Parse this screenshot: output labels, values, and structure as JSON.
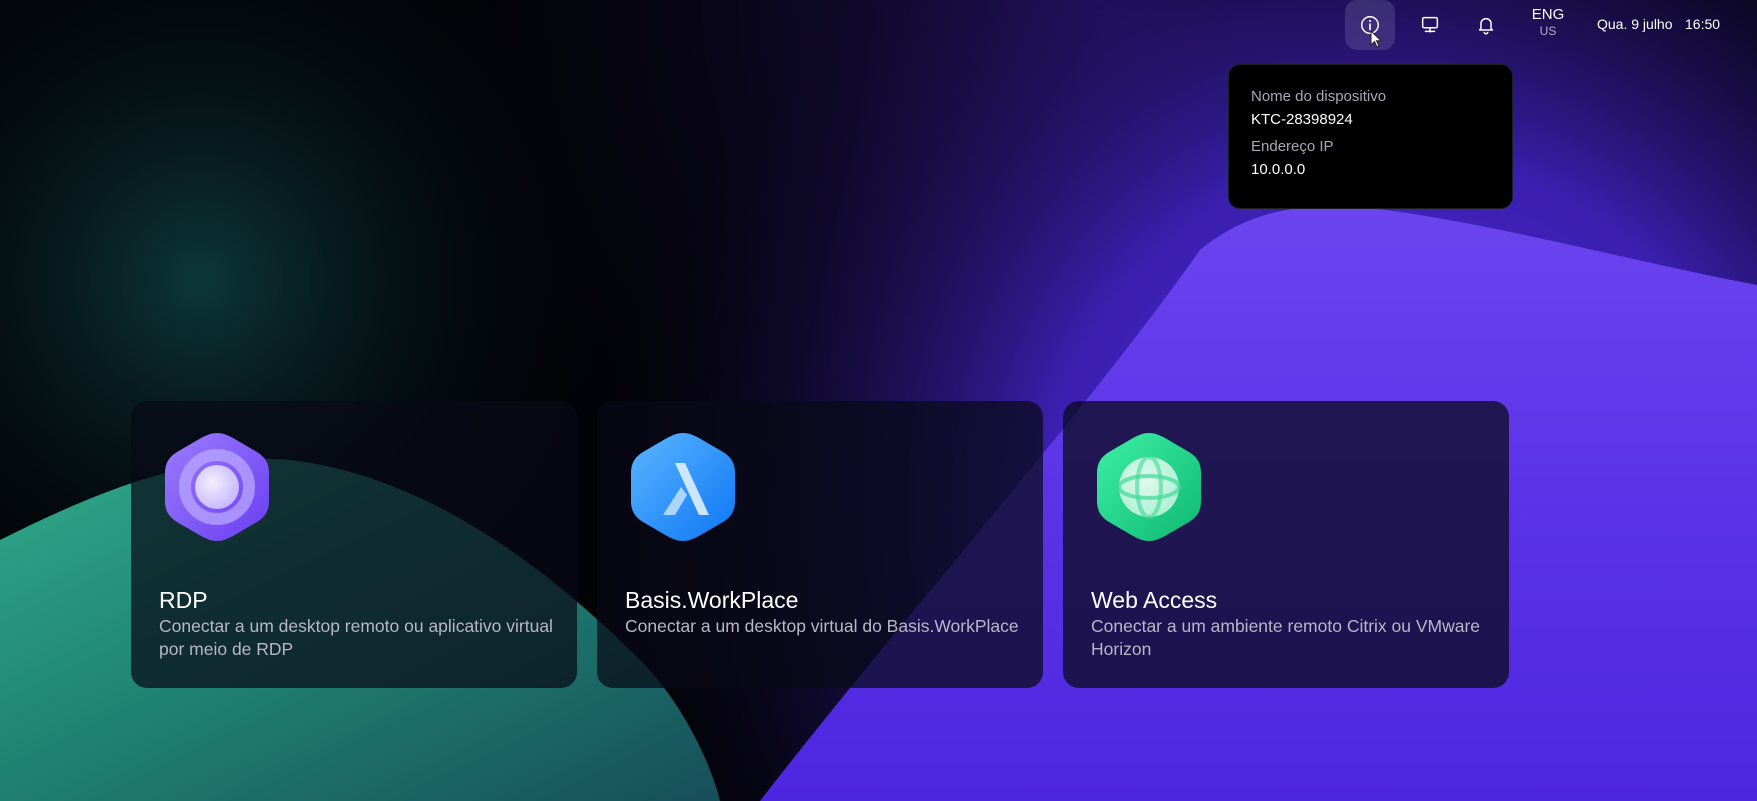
{
  "topbar": {
    "info_icon": "info-circle-icon",
    "display_icon": "monitor-icon",
    "notifications_icon": "bell-icon",
    "language": "ENG",
    "region": "US",
    "date": "Qua. 9 julho",
    "time": "16:50"
  },
  "device_popup": {
    "device_name_label": "Nome do dispositivo",
    "device_name_value": "KTC-28398924",
    "ip_label": "Endereço IP",
    "ip_value": "10.0.0.0"
  },
  "cards": [
    {
      "title": "RDP",
      "description": "Conectar a um desktop remoto ou aplicativo virtual por meio de RDP",
      "icon": "rdp-logo-icon",
      "color": "#7b5cf5"
    },
    {
      "title": "Basis.WorkPlace",
      "description": "Conectar a um desktop virtual do Basis.WorkPlace",
      "icon": "workplace-logo-icon",
      "color": "#1e8cff"
    },
    {
      "title": "Web Access",
      "description": "Conectar a um ambiente remoto Citrix ou VMware Horizon",
      "icon": "web-access-logo-icon",
      "color": "#1ed98c"
    }
  ],
  "colors": {
    "purple_accent": "#6a3df0",
    "teal_accent": "#2aa78a",
    "background": "#020307"
  }
}
